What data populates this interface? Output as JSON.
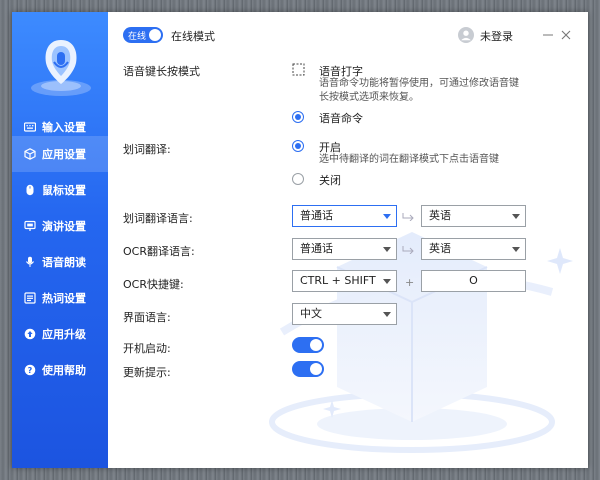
{
  "header": {
    "mode_badge": "在线",
    "mode_label": "在线模式",
    "user_label": "未登录"
  },
  "sidebar": {
    "items": [
      {
        "label": "输入设置",
        "icon": "keyboard-icon",
        "active": false
      },
      {
        "label": "应用设置",
        "icon": "cube-icon",
        "active": true
      },
      {
        "label": "鼠标设置",
        "icon": "mouse-icon",
        "active": false
      },
      {
        "label": "演讲设置",
        "icon": "presentation-icon",
        "active": false
      },
      {
        "label": "语音朗读",
        "icon": "microphone-icon",
        "active": false
      },
      {
        "label": "热词设置",
        "icon": "hotword-icon",
        "active": false
      },
      {
        "label": "应用升级",
        "icon": "upgrade-icon",
        "active": false
      },
      {
        "label": "使用帮助",
        "icon": "help-icon",
        "active": false
      }
    ]
  },
  "settings": {
    "voice_long_press": {
      "label": "语音键长按模式",
      "option1": "语音打字",
      "option1_desc_line1": "语音命令功能将暂停使用，可通过修改语音键",
      "option1_desc_line2": "长按模式选项来恢复。",
      "option2": "语音命令",
      "selected": "语音命令"
    },
    "word_translate": {
      "label": "划词翻译:",
      "on": "开启",
      "on_desc": "选中待翻译的词在翻译模式下点击语音键",
      "off": "关闭",
      "selected": "开启"
    },
    "word_translate_lang": {
      "label": "划词翻译语言:",
      "from": "普通话",
      "to": "英语"
    },
    "ocr_translate_lang": {
      "label": "OCR翻译语言:",
      "from": "普通话",
      "to": "英语"
    },
    "ocr_hotkey": {
      "label": "OCR快捷键:",
      "modifier": "CTRL + SHIFT",
      "plus": "+",
      "key": "O"
    },
    "ui_language": {
      "label": "界面语言:",
      "value": "中文"
    },
    "startup": {
      "label": "开机启动:",
      "enabled": true
    },
    "update_notice": {
      "label": "更新提示:",
      "enabled": true
    }
  },
  "colors": {
    "accent": "#2d6ff2",
    "sidebar_top": "#3d8bff",
    "sidebar_bottom": "#1c54e0"
  }
}
